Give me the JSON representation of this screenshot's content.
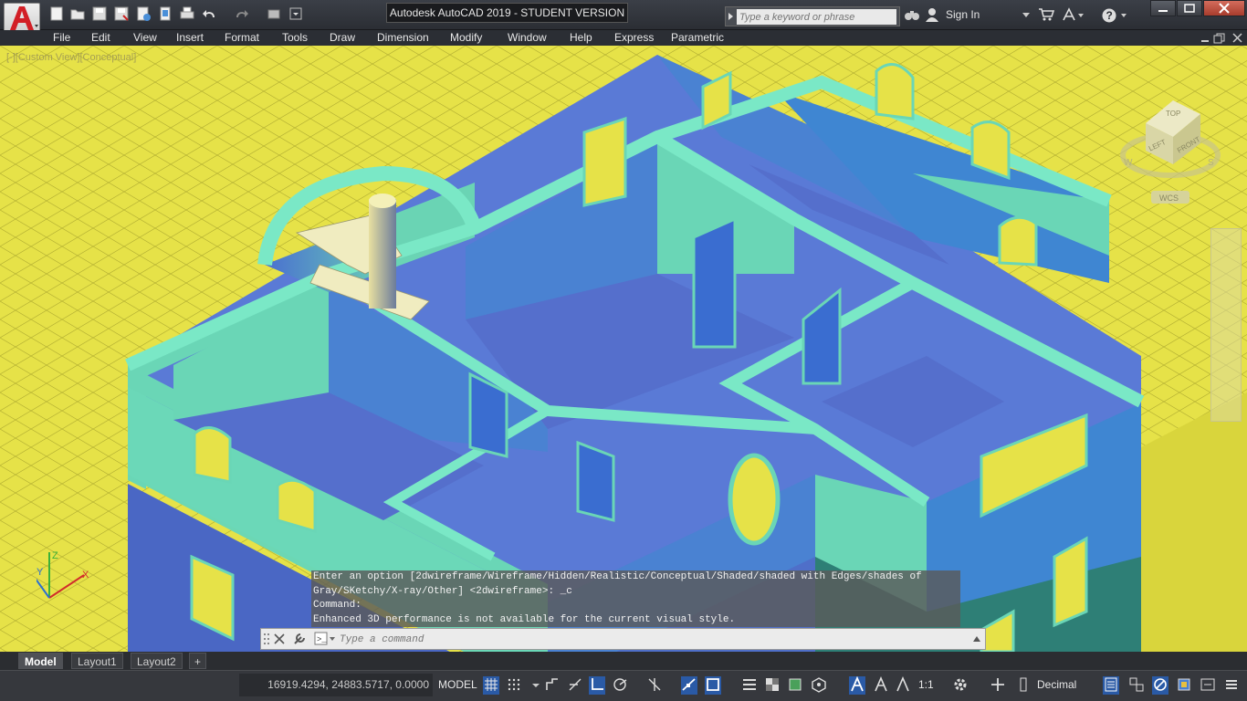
{
  "title_bar": {
    "window_title": "Autodesk AutoCAD 2019 - STUDENT VERSION",
    "search_placeholder": "Type a keyword or phrase",
    "sign_in": "Sign In",
    "app_icon": "autocad-a-icon",
    "quick_access_icons": [
      "new-icon",
      "open-icon",
      "save-icon",
      "save-as-icon",
      "open-web-icon",
      "save-web-icon",
      "plot-icon",
      "undo-icon",
      "redo-icon",
      "workspace-icon",
      "customize-icon"
    ]
  },
  "menu": [
    "File",
    "Edit",
    "View",
    "Insert",
    "Format",
    "Tools",
    "Draw",
    "Dimension",
    "Modify",
    "Window",
    "Help",
    "Express",
    "Parametric"
  ],
  "viewport": {
    "view_label": "[-][Custom View][Conceptual]",
    "viewcube": {
      "top": "TOP",
      "left": "LEFT",
      "front": "FRONT",
      "compass_w": "W",
      "compass_s": "S",
      "ucs": "WCS"
    },
    "background_color": "#e6e248"
  },
  "command": {
    "history": [
      "Enter an option [2dwireframe/Wireframe/Hidden/Realistic/Conceptual/Shaded/shaded with Edges/shades of",
      "Gray/SKetchy/X-ray/Other] <2dwireframe>: _c",
      "Command:",
      "Enhanced 3D performance is not available for the current visual style."
    ],
    "placeholder": "Type a command"
  },
  "tabs": [
    "Model",
    "Layout1",
    "Layout2",
    "+"
  ],
  "status": {
    "coordinates": "16919.4294, 24883.5717, 0.0000",
    "space": "MODEL",
    "annotation_scale": "1:1",
    "units": "Decimal"
  }
}
